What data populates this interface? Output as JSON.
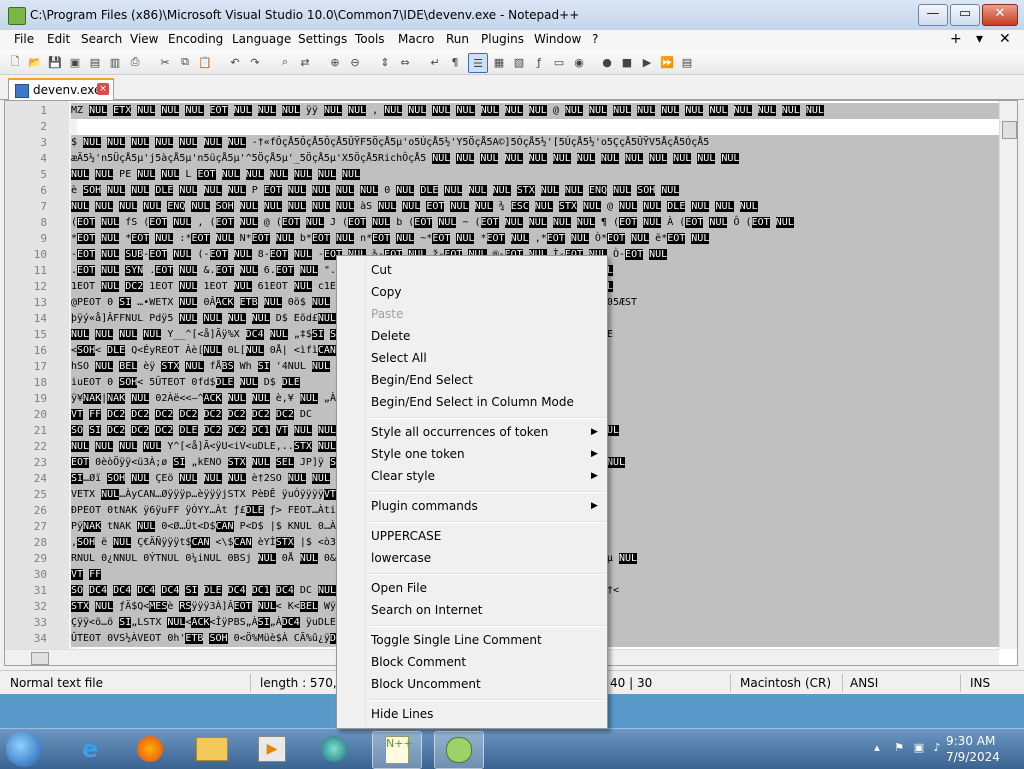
{
  "window": {
    "title": "C:\\Program Files (x86)\\Microsoft Visual Studio 10.0\\Common7\\IDE\\devenv.exe - Notepad++",
    "min_glyph": "—",
    "max_glyph": "▭",
    "close_glyph": "✕"
  },
  "menu": {
    "items": [
      "File",
      "Edit",
      "Search",
      "View",
      "Encoding",
      "Language",
      "Settings",
      "Tools",
      "Macro",
      "Run",
      "Plugins",
      "Window",
      "?"
    ],
    "right": [
      "+",
      "▾",
      "✕"
    ]
  },
  "tab": {
    "label": "devenv.exe",
    "close_glyph": "×"
  },
  "editor": {
    "lines": [
      {
        "n": "1",
        "text": "MZ NUL ETX NUL NUL NUL EOT NUL NUL NUL ÿÿ NUL NUL , NUL NUL NUL NUL NUL NUL NUL @ NUL NUL NUL NUL NUL NUL NUL NUL NUL NUL NUL",
        "sel": true
      },
      {
        "n": "2",
        "text": "",
        "sel": false
      },
      {
        "n": "3",
        "text": "$ NUL NUL NUL NUL NUL NUL NUL -†«fÔçÅ5ÔçÅ5ÔçÅ5ÛŸF5ÖçÅ5µ'o5ÚçÅ5½'Y5ÖçÅ5A©]5ÓçÅ5½'[5ÚçÅ5½'o5ÇçÅ5ÛŸV5ÅçÅ5ÓçÅ5",
        "sel": true
      },
      {
        "n": "4",
        "text": "æÄ5½'n5ÜçÅ5µ'j5àçÅ5µ'n5üçÅ5µ'^5ÖçÅ5µ'_5ÖçÅ5µ'X5ÖçÅ5RichÔçÅ5 NUL NUL NUL NUL NUL NUL NUL NUL NUL NUL NUL NUL NUL",
        "sel": true
      },
      {
        "n": "5",
        "text": "NUL NUL PE NUL NUL L EOT NUL NUL NUL NUL NUL NUL",
        "sel": true
      },
      {
        "n": "6",
        "text": "è SOH NUL NUL DLE NUL NUL NUL P EOT NUL NUL NUL NUL 0 NUL DLE NUL NUL NUL STX NUL NUL ENQ NUL SOH NUL",
        "sel": true
      },
      {
        "n": "7",
        "text": "NUL NUL NUL NUL ENQ NUL SOH NUL NUL NUL NUL NUL àS NUL NUL EOT NUL NUL ¾ ESC NUL STX NUL @ NUL NUL DLE NUL NUL NUL",
        "sel": true
      },
      {
        "n": "8",
        "text": "(EOT NUL fS (EOT NUL , (EOT NUL @ (EOT NUL J (EOT NUL b (EOT NUL ~ (EOT NUL NUL NUL NUL ¶ (EOT NUL À (EOT NUL Ô (EOT NUL",
        "sel": true
      },
      {
        "n": "9",
        "text": "*EOT NUL *EOT NUL :*EOT NUL N*EOT NUL b*EOT NUL n*EOT NUL ~*EOT NUL *EOT NUL ,*EOT NUL Ò*EOT NUL ë*EOT NUL",
        "sel": true
      },
      {
        "n": "10",
        "text": "-EOT NUL SUB-EOT NUL (-EOT NUL 8-EOT NUL -EOT NUL ¾-EOT NUL ž-EOT NUL ®-EOT NUL Ì-EOT NUL Ò-EOT NUL",
        "sel": true
      },
      {
        "n": "11",
        "text": ".EOT NUL SYN .EOT NUL &.EOT NUL 6.EOT NUL \".EOT NUL ,EOT NUL 4.EOT NUL Ò.EOT NUL Þ.EOT NUL",
        "sel": true
      },
      {
        "n": "12",
        "text": "1EOT NUL DC2 1EOT NUL 1EOT NUL 61EOT NUL c1EOT NUL Ê1EOT NUL Ú1EOT NUL è1EOT NUL ø1EOT NUL",
        "sel": true
      },
      {
        "n": "13",
        "text": "@PEOT 0 SI …•WETX NUL 0ÂACK ETB NUL 0ö$ NUL 0'eNUL 00+ETX 0|TNUL 0%SUB STX 0!nNUL 0@ÇSTX 05ÆST",
        "sel": true
      },
      {
        "n": "14",
        "text": "þÿý«å]ÂFFNUL Pdÿ5 NUL NUL NUL NUL D$ Eõd£NUL NUL NUL NUL Å<Môdb",
        "sel": true
      },
      {
        "n": "15",
        "text": "NUL NUL NUL NUL Y__^[<å]Ãÿ%X DC4 NUL „‡$SI SOH NUL ,XPEOT 0èÅÿÿÿÅ<ÿU<ì]ÿ%dPEOT 0<ÿU<ì]ÿ%hE",
        "sel": true
      },
      {
        "n": "16",
        "text": "<SOH< DLE Q<ÉyREOT Àè[NUL 0L[NUL 0Å| <ìfìCAN SVW<}DLE 3ÛûSI,ÿ0STX NUL<MFE,^Þÿÿ;ƒSIŽ",
        "sel": true
      },
      {
        "n": "17",
        "text": "hSO NUL BEL èÿ STX NUL fÅBS Wh SI '4NUL NUL hÂVT NUL NUL ÿ5ÅVEOT 0%t$CAN t$CAN è' STX NUL",
        "sel": true
      },
      {
        "n": "18",
        "text": "iuEOT 0 SOH< 5ÛTEOT 0fd$DLE NUL D$ DLE",
        "sel": true
      },
      {
        "n": "19",
        "text": "ÿ¥NAK|NAK NUL 02Àë<<—^ACK NUL NUL è,¥ NUL „Àti<Ö<ÌèSI°STX NUL ÿt$DLE „ÀtÃÿNAK|NAK NUL 0°S",
        "sel": true
      },
      {
        "n": "20",
        "text": "VT FF DC2 DC2 DC2 DC2 DC2 DC2 DC2 DC2 DC",
        "sel": true
      },
      {
        "n": "21",
        "text": "SO SI DC2 DC2 DC2 DLE DC2 DC2 DC1 VT NUL NUL dNUL IINUL 0NUL INUL 6NUL NUL 0NUL NUL NUL NUL",
        "sel": true
      },
      {
        "n": "22",
        "text": "NUL NUL NUL NUL Y^[<å]Ã<ÿU<iV<uDLE,..STX NUL W<}FF HÀè7ÿÿÿ%ACK 3À_^]ÂFF NUL jl,€ EOT 0èëü",
        "sel": true
      },
      {
        "n": "23",
        "text": "EOT 0èòÖÿÿ<ü3À;ø SI „kENO STX NUL SEL JP]ÿ SI „KENQ STX NUL EM NUL STX NUL ÿuiEðhSOH NUL NUL",
        "sel": true
      },
      {
        "n": "24",
        "text": "SI…Øï SOH NUL ÇEö NUL NUL NUL è†2SO NUL NUL NUL ÿ5ÅVEOT 0%t$CAN ÿuE NUL NUL NUL NUL ÿ",
        "sel": true
      },
      {
        "n": "25",
        "text": "VETX NUL…ÀyCAN…Øÿÿÿp…èÿÿÿjSTX PèÐÊ ÿuÓÿÿÿÿVT'STX NUL EüSOH ÿµÿÿÿ<=|NAK NUL 0<Øÿ×µÜÿÿÿ",
        "sel": true
      },
      {
        "n": "26",
        "text": "ÐPEOT 0tNAK ÿ6ÿuFF ÿÓYY…Àt ƒ£DLE ƒ> FEOT…Àti<NUL è SI…Àtç<ACK…Àt DC2",
        "sel": true
      },
      {
        "n": "27",
        "text": "PÿNAK tNAK NUL 0<Ø…Ût<D$CAN P<D$ |$ KNUL 0…ÀSI,-ETB NUL NUL è»jDD$<jNUL PèüÊÿÿƒFF'FF",
        "sel": true
      },
      {
        "n": "28",
        "text": ",SOH ë NUL Ç€ÄÑÿÿÿt$CAN <\\$CAN èYÌSTX |$ <ò3Âö$t†$CAN SI…ESC DC2 NUL NUL <ETX<ÉýP4,Àt'<T",
        "sel": true
      },
      {
        "n": "29",
        "text": "RNUL 0¿NNUL 0ÝTNUL 0¼iNUL 0BSj NUL 0Å NUL 0&,NUL 0K,NUL 0‡,NUL 0…MNUL 0SO NUL 0SUB àNUL 0µ NUL",
        "sel": true
      },
      {
        "n": "30",
        "text": "VT FF",
        "sel": true
      },
      {
        "n": "31",
        "text": "SO DC4 DC4 DC4 DC4 SI DLE DC4 DC1 DC4 DC NUL 0ŒNUL 0FS<NUL 0èƒNUL 0vdNUL 0'‰NUL 0sj NUL 0†<",
        "sel": true
      },
      {
        "n": "32",
        "text": "STX NUL ƒÄ$Q<MESè RSÿÿÿ3À]ÂEOT NUL< K<BEL WÿPEOT<ACK…ÀSI…cÆSOH NUL %>‹Ç_^]BS NUL NUL %",
        "sel": true
      },
      {
        "n": "33",
        "text": "Çÿÿ<ö…ö SI„LSTX NUL<ACK<ÎÿPBS„ÀSI„ÀDC4 ÿuDLE ÿuFF è¼ÿÿÿ]ÂDC4 NUL f1$EOT @è ENQ Åÿÿf1$EOT",
        "sel": true
      },
      {
        "n": "34",
        "text": "ÛTEOT 0VS½ÀVEOT 0h'ETB SOH 0<Ö%Müè$À CÃ%û¿ÿDLE ENQ ENQ @NUL €[ÉÂ%USë«ÆNUL<ÿU<ifäøjÿh",
        "sel": true
      }
    ]
  },
  "context_menu": {
    "items": [
      "Cut",
      "Copy",
      "Paste",
      "Delete",
      "Select All",
      "Begin/End Select",
      "Begin/End Select in Column Mode",
      "Style all occurrences of token",
      "Style one token",
      "Clear style",
      "Plugin commands",
      "UPPERCASE",
      "lowercase",
      "Open File",
      "Search on Internet",
      "Toggle Single Line Comment",
      "Block Comment",
      "Block Uncomment",
      "Hide Lines"
    ],
    "submenu_glyph": "▶"
  },
  "status": {
    "type": "Normal text file",
    "length": "length : 570,18",
    "position": "40 | 30",
    "eol": "Macintosh (CR)",
    "encoding": "ANSI",
    "mode": "INS"
  },
  "taskbar": {
    "time": "9:30 AM",
    "date": "7/9/2024"
  },
  "colors": {
    "selection": "#c0c0c0",
    "control_char_bg": "#000000",
    "tab_accent": "#f7a21a"
  }
}
